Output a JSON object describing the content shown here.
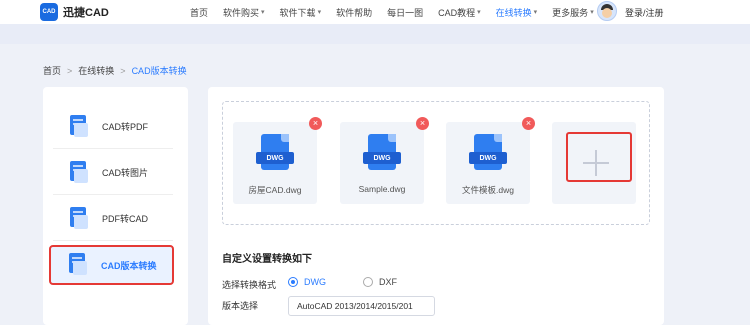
{
  "header": {
    "logo_mark": "CAD",
    "brand": "迅捷CAD",
    "nav": [
      {
        "label": "首页",
        "caret": false
      },
      {
        "label": "软件购买",
        "caret": true
      },
      {
        "label": "软件下载",
        "caret": true
      },
      {
        "label": "软件帮助",
        "caret": false
      },
      {
        "label": "每日一图",
        "caret": false
      },
      {
        "label": "CAD教程",
        "caret": true
      },
      {
        "label": "在线转换",
        "caret": true,
        "active": true
      },
      {
        "label": "更多服务",
        "caret": true
      }
    ],
    "login": "登录/注册"
  },
  "breadcrumb": {
    "home": "首页",
    "section": "在线转换",
    "current": "CAD版本转换",
    "sep": ">"
  },
  "sidebar": {
    "items": [
      {
        "label": "CAD转PDF"
      },
      {
        "label": "CAD转图片"
      },
      {
        "label": "PDF转CAD"
      },
      {
        "label": "CAD版本转换",
        "active": true
      }
    ]
  },
  "files": [
    {
      "name": "房屋CAD.dwg",
      "tag": "DWG"
    },
    {
      "name": "Sample.dwg",
      "tag": "DWG"
    },
    {
      "name": "文件模板.dwg",
      "tag": "DWG"
    }
  ],
  "settings": {
    "title": "自定义设置转换如下",
    "format_label": "选择转换格式",
    "format_options": [
      "DWG",
      "DXF"
    ],
    "format_selected": "DWG",
    "version_label": "版本选择",
    "version_value": "AutoCAD 2013/2014/2015/201"
  },
  "colors": {
    "accent": "#2b7cff",
    "highlight": "#e53935",
    "remove": "#f15a5a"
  }
}
